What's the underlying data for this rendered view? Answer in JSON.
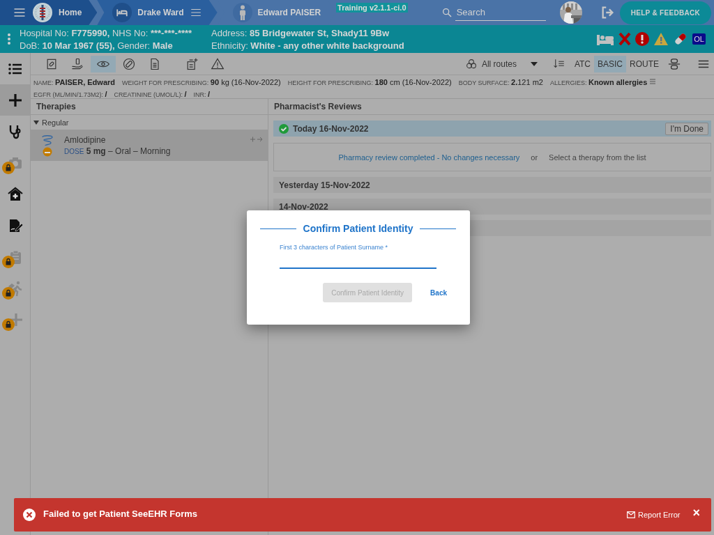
{
  "top_bar": {
    "home": "Home",
    "ward": "Drake Ward",
    "patient": "Edward PAISER",
    "version": "Training v2.1.1-ci.0",
    "search": {
      "placeholder": "Search"
    },
    "help_button": "HELP & FEEDBACK"
  },
  "patient_banner": {
    "columns": [
      [
        [
          {
            "label": "Hospital No:",
            "value": "F775990,"
          },
          {
            "label": "NHS No:",
            "value": "***-***-****"
          }
        ],
        [
          {
            "label": "DoB:",
            "value": "10 Mar 1967 (55),"
          },
          {
            "label": "Gender:",
            "value": "Male"
          }
        ]
      ],
      [
        [
          {
            "label": "Address:",
            "value": "85 Bridgewater St, Shady11 9Bw"
          }
        ],
        [
          {
            "label": "Ethnicity:",
            "value": "White - any other white background"
          }
        ]
      ]
    ],
    "badge": "OL"
  },
  "toolbar": {
    "buttons": [
      {
        "selected": false
      },
      {
        "selected": false
      },
      {
        "selected": true
      },
      {
        "selected": false
      },
      {
        "selected": false
      },
      {
        "selected": false
      },
      {
        "selected": false
      }
    ],
    "route_filter": "All routes",
    "views": [
      {
        "label": "ATC",
        "selected": false
      },
      {
        "label": "BASIC",
        "selected": true
      },
      {
        "label": "ROUTE",
        "selected": false
      }
    ]
  },
  "patient_info": [
    {
      "label": "NAME:",
      "value": "**PAISER, Edward**"
    },
    {
      "label": "WEIGHT FOR PRESCRIBING:",
      "value": "**90** kg (16-Nov-2022)"
    },
    {
      "label": "HEIGHT FOR PRESCRIBING:",
      "value": "**180** cm (16-Nov-2022)"
    },
    {
      "label": "BODY SURFACE:",
      "value": "**2.**121 m2"
    },
    {
      "label": "ALLERGIES:",
      "value": "**Known allergies**",
      "menu": true
    },
    {
      "label": "EGFR (ML/MIN/1.73M2):",
      "value": "**/**"
    },
    {
      "label": "CREATININE (UMOL/L):",
      "value": "**/**"
    },
    {
      "label": "INR:",
      "value": "**/**"
    }
  ],
  "side_nav": [
    {
      "selected": false,
      "locked": false
    },
    {
      "selected": true,
      "locked": false
    },
    {
      "selected": false,
      "locked": false
    },
    {
      "selected": false,
      "locked": true
    },
    {
      "selected": false,
      "locked": false
    },
    {
      "selected": false,
      "locked": false
    },
    {
      "selected": false,
      "locked": true
    },
    {
      "selected": false,
      "locked": true
    },
    {
      "selected": false,
      "locked": true
    }
  ],
  "therapies": {
    "title": "Therapies",
    "groups": [
      {
        "label": "Regular",
        "expanded": true,
        "items": [
          {
            "name": "Amlodipine",
            "dose_label": "DOSE",
            "dose": "**5 mg** – Oral – Morning",
            "selected": true
          }
        ]
      }
    ]
  },
  "reviews": {
    "title": "Pharmacist's Reviews",
    "days": [
      {
        "label": "Today 16-Nov-2022",
        "current": true,
        "button": "I'm Done"
      },
      {
        "label": "Yesterday 15-Nov-2022",
        "current": false
      },
      {
        "label": "14-Nov-2022",
        "current": false
      }
    ],
    "action_link": "Pharmacy review completed - No changes necessary",
    "or": "or",
    "hint": "Select a therapy from the list"
  },
  "dialog": {
    "title": "Confirm Patient Identity",
    "field_label": "First 3 characters of Patient Surname *",
    "confirm_button": {
      "label": "Confirm Patient Identity",
      "disabled": true
    },
    "back_button": "Back"
  },
  "toast": {
    "message": "Failed to get Patient SeeEHR Forms",
    "report": "Report Error",
    "close": "×"
  }
}
